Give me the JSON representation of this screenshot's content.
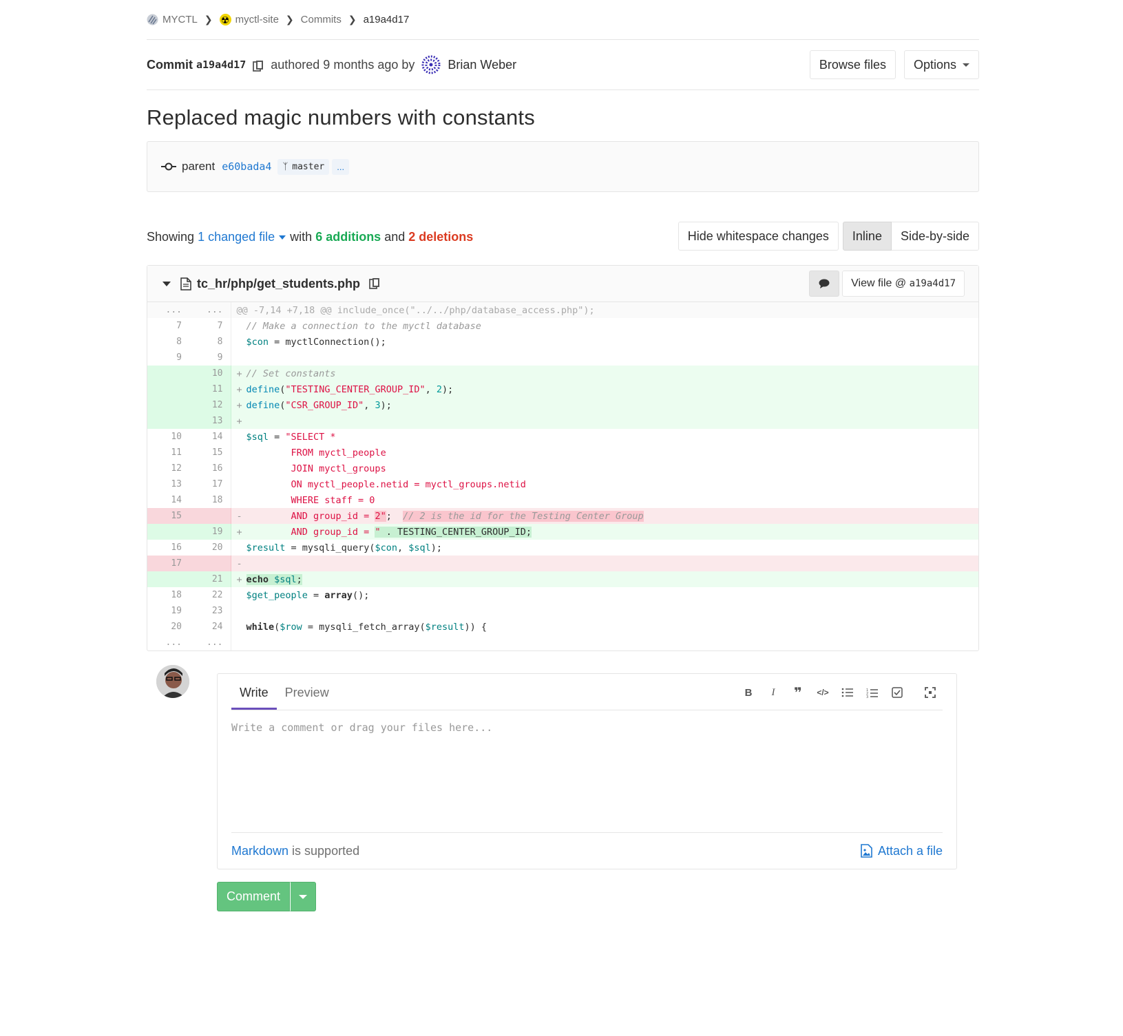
{
  "breadcrumb": {
    "group": "MYCTL",
    "project": "myctl-site",
    "section": "Commits",
    "current": "a19a4d17"
  },
  "commit": {
    "label": "Commit",
    "sha": "a19a4d17",
    "authored_text": "authored 9 months ago by",
    "author": "Brian Weber",
    "browse_files": "Browse files",
    "options": "Options",
    "title": "Replaced magic numbers with constants",
    "parent_label": "parent",
    "parent_sha": "e60bada4",
    "branch": "master",
    "more": "..."
  },
  "stats": {
    "showing": "Showing",
    "changed": "1 changed file",
    "with": "with",
    "additions": "6 additions",
    "and": "and",
    "deletions": "2 deletions",
    "hide_whitespace": "Hide whitespace changes",
    "inline": "Inline",
    "side_by_side": "Side-by-side"
  },
  "file": {
    "path": "tc_hr/php/get_students.php",
    "view_file": "View file @ ",
    "view_sha": "a19a4d17"
  },
  "form": {
    "tab_write": "Write",
    "tab_preview": "Preview",
    "placeholder": "Write a comment or drag your files here...",
    "markdown": "Markdown",
    "supported": " is supported",
    "attach": "Attach a file",
    "comment_button": "Comment"
  },
  "colors": {
    "link": "#1f78d1",
    "addition": "#1aaa55",
    "deletion": "#db3b21",
    "comment_button": "#64c47f",
    "active_tab": "#6b4fbb"
  }
}
